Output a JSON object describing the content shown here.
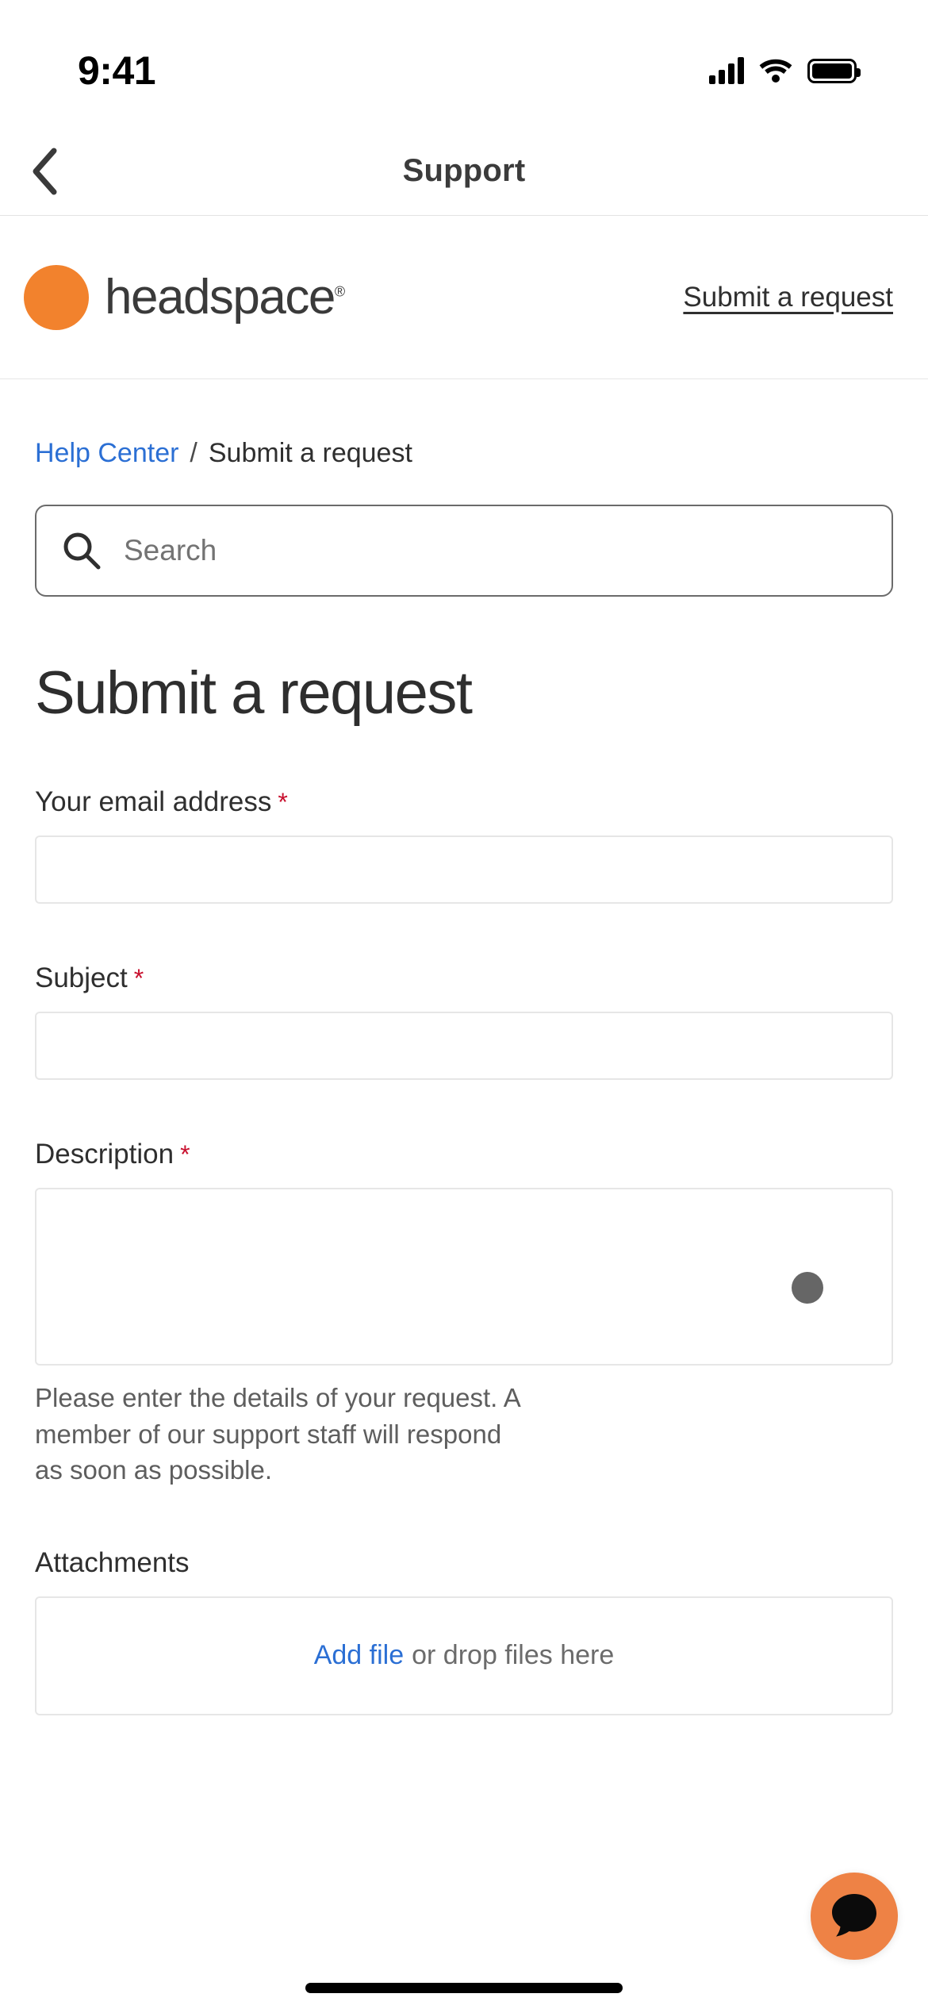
{
  "status_bar": {
    "time": "9:41",
    "cellular_icon": "signal-bars-icon",
    "wifi_icon": "wifi-icon",
    "battery_icon": "battery-icon"
  },
  "nav": {
    "back_icon": "back-chevron-icon",
    "title": "Support"
  },
  "brand": {
    "logo_icon": "headspace-logo-icon",
    "wordmark": "headspace",
    "registered_mark": "®",
    "action_label": "Submit a request",
    "accent_color": "#f2822d"
  },
  "breadcrumb": {
    "home_label": "Help Center",
    "separator": "/",
    "current_label": "Submit a request",
    "link_color": "#2b6fd4"
  },
  "search": {
    "icon": "search-icon",
    "placeholder": "Search",
    "value": ""
  },
  "page": {
    "title": "Submit a request"
  },
  "form": {
    "required_marker": "*",
    "required_color": "#c8102e",
    "fields": [
      {
        "label": "Your email address",
        "required": true,
        "value": ""
      },
      {
        "label": "Subject",
        "required": true,
        "value": ""
      },
      {
        "label": "Description",
        "required": true,
        "value": ""
      }
    ],
    "description_helper": "Please enter the details of your request. A member of our support staff will respond as soon as possible.",
    "attachments_label": "Attachments",
    "attachments": {
      "add_file_label": "Add file",
      "drop_hint": "or drop files here"
    }
  },
  "chat_widget": {
    "icon": "chat-bubble-icon",
    "background_color": "#ee8245"
  }
}
